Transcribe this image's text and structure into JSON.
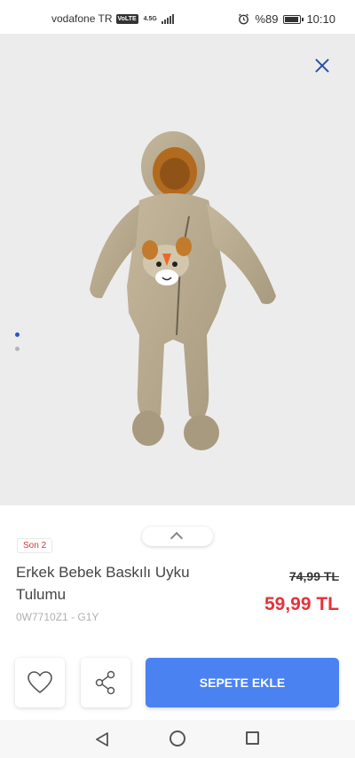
{
  "status_bar": {
    "carrier": "vodafone TR",
    "volte": "VoLTE",
    "network": "4.5G",
    "battery": "%89",
    "time": "10:10",
    "alarm_icon": "alarm-icon"
  },
  "gallery": {
    "close_icon": "close-icon",
    "image_count": 2,
    "active_index": 0
  },
  "product": {
    "badge": "Son 2",
    "title": "Erkek Bebek Baskılı Uyku Tulumu",
    "sku": "0W7710Z1 - G1Y",
    "old_price": "74,99 TL",
    "new_price": "59,99 TL"
  },
  "actions": {
    "favorite_icon": "heart-icon",
    "share_icon": "share-icon",
    "add_to_cart": "SEPETE EKLE"
  },
  "nav": {
    "back_icon": "back-triangle-icon",
    "home_icon": "home-circle-icon",
    "recent_icon": "recent-square-icon"
  },
  "colors": {
    "accent_blue": "#4a82f1",
    "price_red": "#e5323a",
    "close_blue": "#2b4fa8",
    "image_bg": "#ececec"
  }
}
